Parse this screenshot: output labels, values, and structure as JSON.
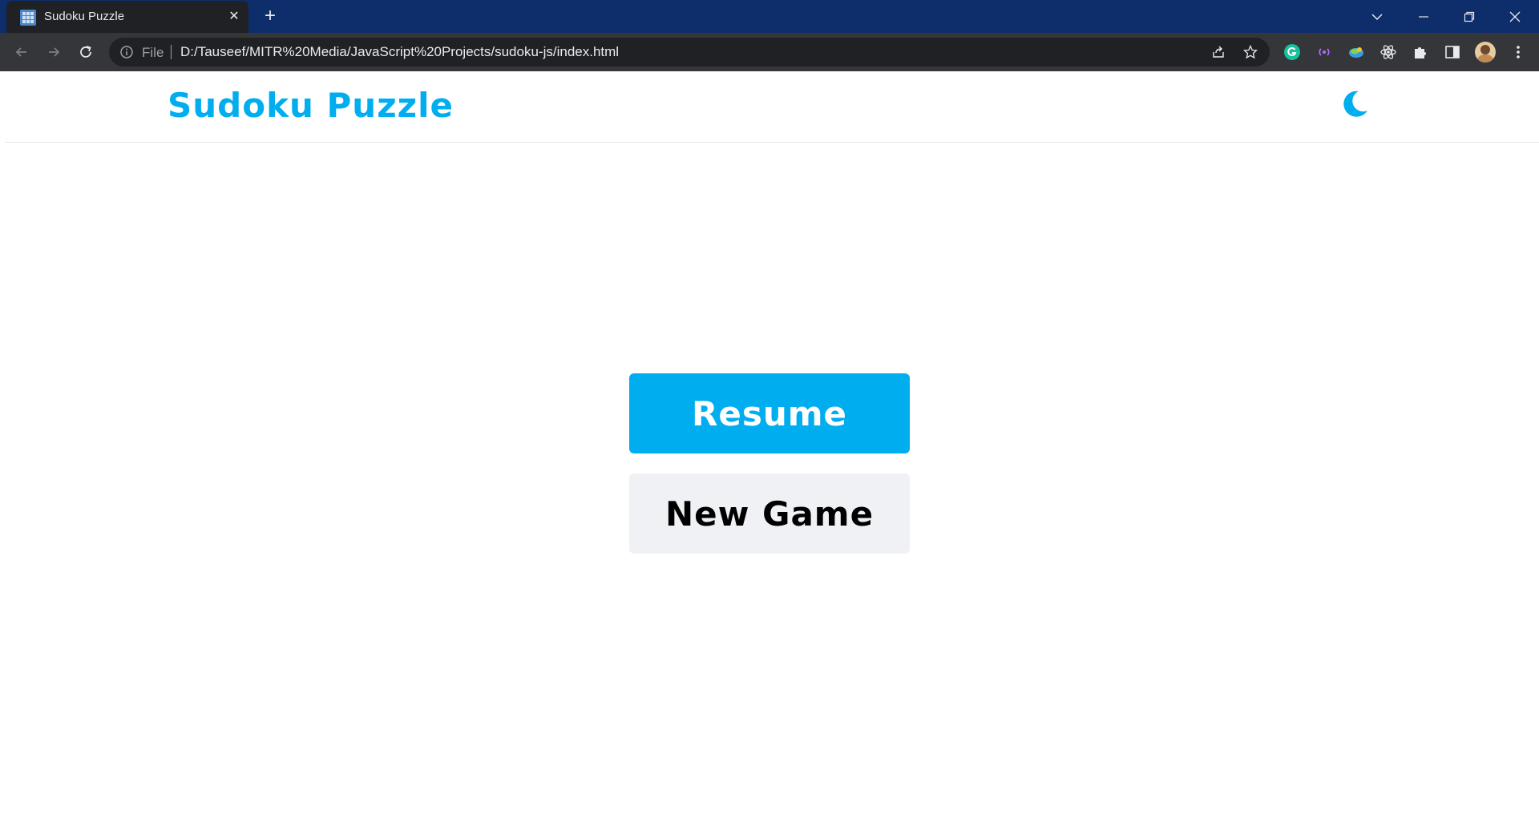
{
  "browser": {
    "tab_title": "Sudoku Puzzle",
    "omnibox": {
      "scheme_label": "File",
      "url": "D:/Tauseef/MITR%20Media/JavaScript%20Projects/sudoku-js/index.html"
    }
  },
  "page": {
    "logo": "Sudoku Puzzle",
    "buttons": {
      "resume": "Resume",
      "new_game": "New Game"
    }
  },
  "colors": {
    "accent": "#00aeef",
    "secondary_button": "#f0f1f5",
    "titlebar": "#0d2d6b",
    "toolbar": "#35363a"
  }
}
